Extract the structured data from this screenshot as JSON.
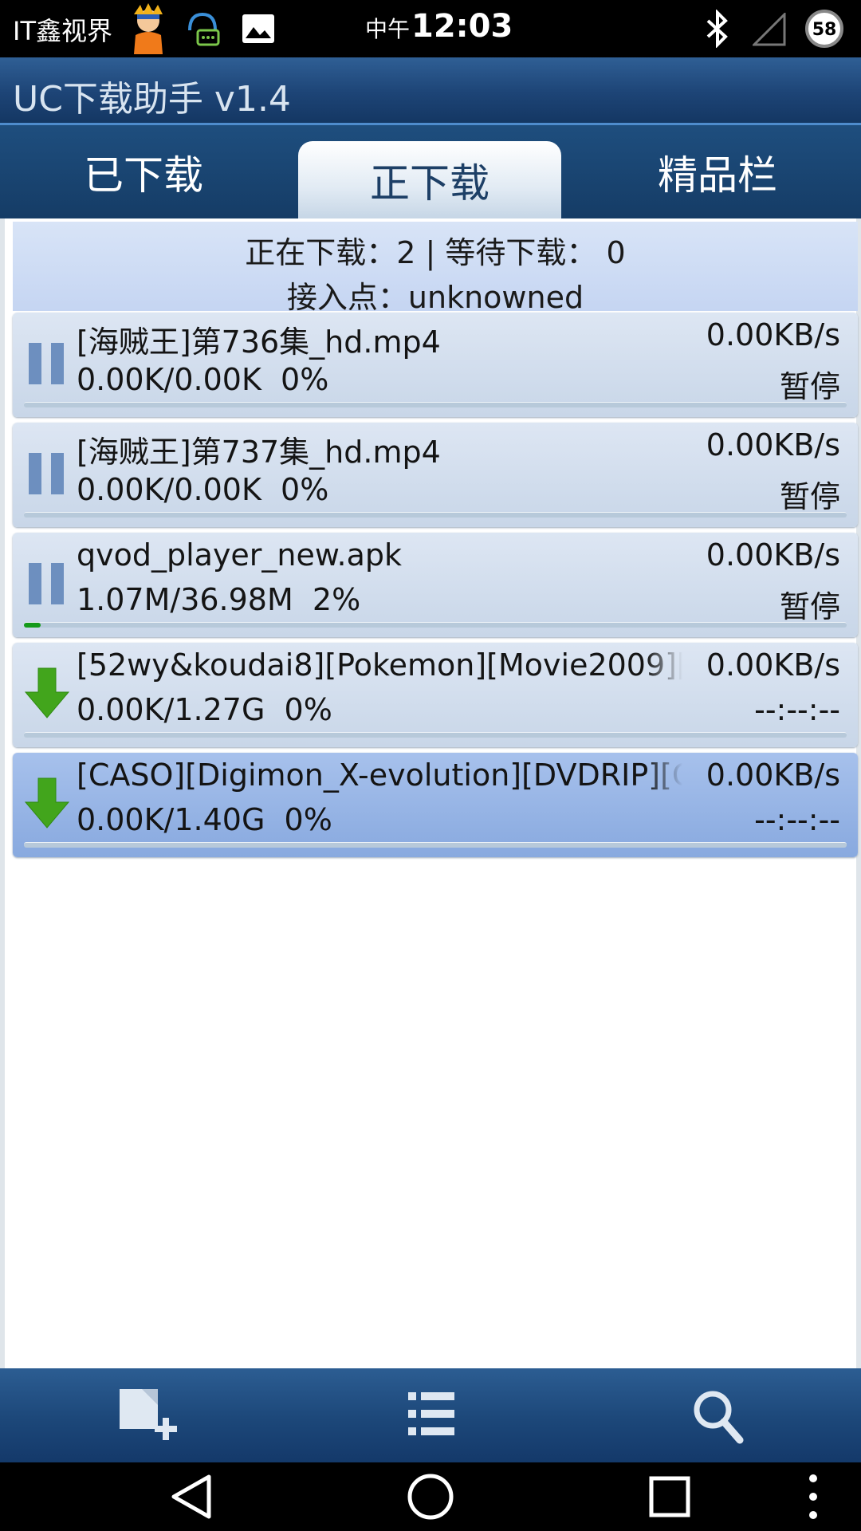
{
  "status_bar": {
    "carrier": "IT鑫视界",
    "time_prefix": "中午",
    "time": "12:03",
    "battery_level": "58",
    "icons": [
      "avatar-icon",
      "message-icon",
      "image-icon",
      "bluetooth-icon",
      "signal-icon",
      "battery-icon"
    ]
  },
  "app": {
    "title": "UC下载助手 v1.4"
  },
  "tabs": [
    {
      "label": "已下载",
      "active": false
    },
    {
      "label": "正下载",
      "active": true
    },
    {
      "label": "精品栏",
      "active": false
    }
  ],
  "summary": {
    "line1": "正在下载：2 | 等待下载： 0",
    "line2": "接入点：unknowned"
  },
  "downloads": [
    {
      "name": "[海贼王]第736集_hd.mp4",
      "progress_text": "0.00K/0.00K  0%",
      "speed": "0.00KB/s",
      "status": "暂停",
      "icon": "pause-icon",
      "progress_percent": 0
    },
    {
      "name": "[海贼王]第737集_hd.mp4",
      "progress_text": "0.00K/0.00K  0%",
      "speed": "0.00KB/s",
      "status": "暂停",
      "icon": "pause-icon",
      "progress_percent": 0
    },
    {
      "name": "qvod_player_new.apk",
      "progress_text": "1.07M/36.98M  2%",
      "speed": "0.00KB/s",
      "status": "暂停",
      "icon": "pause-icon",
      "progress_percent": 2
    },
    {
      "name": "[52wy&koudai8][Pokemon][Movie2009][",
      "progress_text": "0.00K/1.27G  0%",
      "speed": "0.00KB/s",
      "status": "--:--:--",
      "icon": "download-arrow-icon",
      "progress_percent": 0
    },
    {
      "name": "[CASO][Digimon_X-evolution][DVDRIP][G",
      "progress_text": "0.00K/1.40G  0%",
      "speed": "0.00KB/s",
      "status": "--:--:--",
      "icon": "download-arrow-icon",
      "progress_percent": 0,
      "selected": true
    }
  ],
  "bottom_bar": {
    "buttons": [
      {
        "icon": "add-task-icon"
      },
      {
        "icon": "list-icon"
      },
      {
        "icon": "search-icon"
      }
    ]
  },
  "nav_bar": {
    "buttons": [
      {
        "icon": "back-icon"
      },
      {
        "icon": "home-icon"
      },
      {
        "icon": "recents-icon"
      },
      {
        "icon": "overflow-menu-icon"
      }
    ]
  },
  "colors": {
    "title_bar": "#1d4476",
    "row_background": "#c8d6e8",
    "row_selected": "#88a9df",
    "progress_fill": "#149a1a",
    "download_arrow": "#42a51c"
  }
}
